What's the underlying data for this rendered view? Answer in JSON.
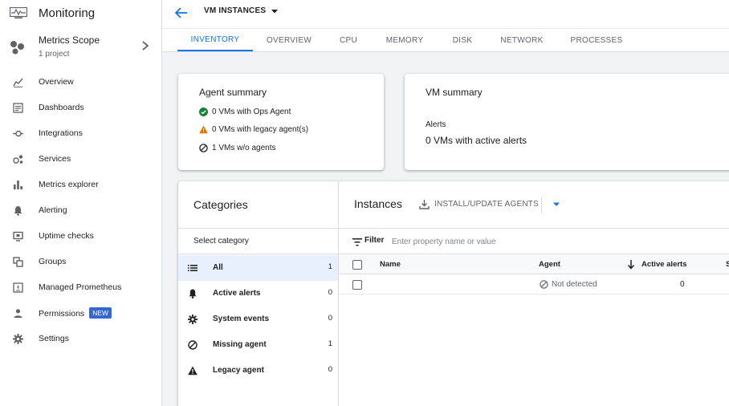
{
  "app": {
    "title": "Monitoring"
  },
  "scope": {
    "name": "Metrics Scope",
    "subtitle": "1 project"
  },
  "nav": [
    {
      "label": "Overview",
      "icon": "overview-icon"
    },
    {
      "label": "Dashboards",
      "icon": "dashboards-icon"
    },
    {
      "label": "Integrations",
      "icon": "integrations-icon"
    },
    {
      "label": "Services",
      "icon": "services-icon"
    },
    {
      "label": "Metrics explorer",
      "icon": "bar-chart-icon"
    },
    {
      "label": "Alerting",
      "icon": "bell-icon"
    },
    {
      "label": "Uptime checks",
      "icon": "monitor-icon"
    },
    {
      "label": "Groups",
      "icon": "groups-icon"
    },
    {
      "label": "Managed Prometheus",
      "icon": "prometheus-icon"
    },
    {
      "label": "Permissions",
      "icon": "person-icon",
      "badge": "NEW"
    },
    {
      "label": "Settings",
      "icon": "gear-icon"
    }
  ],
  "header": {
    "title": "VM INSTANCES"
  },
  "tabs": [
    "INVENTORY",
    "OVERVIEW",
    "CPU",
    "MEMORY",
    "DISK",
    "NETWORK",
    "PROCESSES"
  ],
  "agent_summary": {
    "title": "Agent summary",
    "rows": [
      "0 VMs with Ops Agent",
      "0 VMs with legacy agent(s)",
      "1 VMs w/o agents"
    ]
  },
  "vm_summary": {
    "title": "VM summary",
    "alerts_label": "Alerts",
    "alerts_value": "0 VMs with active alerts"
  },
  "categories": {
    "title": "Categories",
    "select_label": "Select category",
    "items": [
      {
        "label": "All",
        "count": "1"
      },
      {
        "label": "Active alerts",
        "count": "0"
      },
      {
        "label": "System events",
        "count": "0"
      },
      {
        "label": "Missing agent",
        "count": "1"
      },
      {
        "label": "Legacy agent",
        "count": "0"
      }
    ]
  },
  "instances": {
    "title": "Instances",
    "install_label": "INSTALL/UPDATE AGENTS",
    "filter_label": "Filter",
    "filter_placeholder": "Enter property name or value",
    "columns": {
      "name": "Name",
      "agent": "Agent",
      "alerts": "Active alerts",
      "extra": "S"
    },
    "rows": [
      {
        "name": "",
        "agent": "Not detected",
        "alerts": "0"
      }
    ]
  },
  "colors": {
    "accent": "#1a73e8",
    "success": "#188038",
    "warning": "#e37400",
    "badge": "#3367d6"
  }
}
